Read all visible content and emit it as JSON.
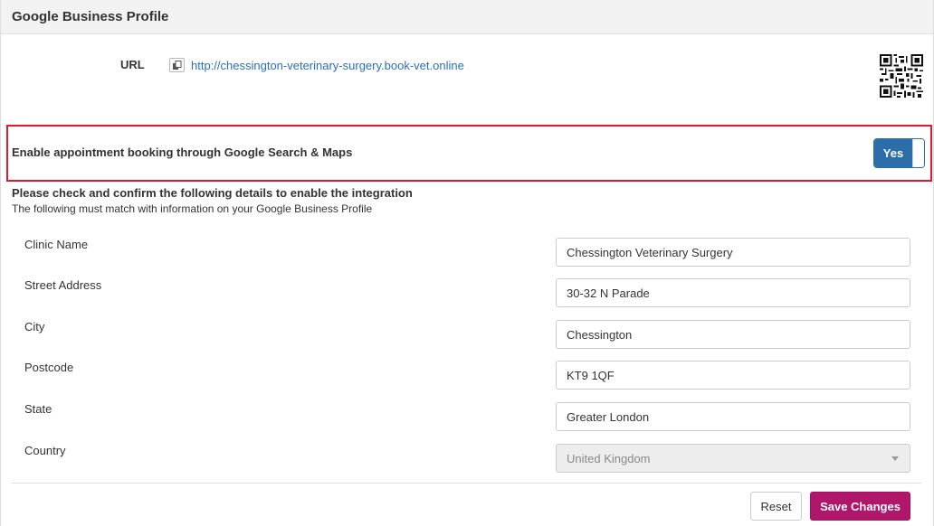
{
  "panel": {
    "title": "Google Business Profile"
  },
  "url_row": {
    "label": "URL",
    "link": "http://chessington-veterinary-surgery.book-vet.online",
    "copy_icon": "copy-icon",
    "qr_icon": "qr-code-icon"
  },
  "booking": {
    "label": "Enable appointment booking through Google Search & Maps",
    "toggle_label": "Yes",
    "toggle_on": true,
    "highlight_color": "#e0192d",
    "toggle_color": "#2c6ea9"
  },
  "instructions": {
    "title": "Please check and confirm the following details to enable the integration",
    "subtitle": "The following must match with information on your Google Business Profile"
  },
  "fields": [
    {
      "label": "Clinic Name",
      "value": "Chessington Veterinary Surgery"
    },
    {
      "label": "Street Address",
      "value": "30-32 N Parade"
    },
    {
      "label": "City",
      "value": "Chessington"
    },
    {
      "label": "Postcode",
      "value": "KT9 1QF"
    },
    {
      "label": "State",
      "value": "Greater London"
    },
    {
      "label": "Country",
      "value": "United Kingdom"
    }
  ],
  "actions": {
    "reset_label": "Reset",
    "save_label": "Save Changes",
    "save_color": "#b0166a"
  }
}
